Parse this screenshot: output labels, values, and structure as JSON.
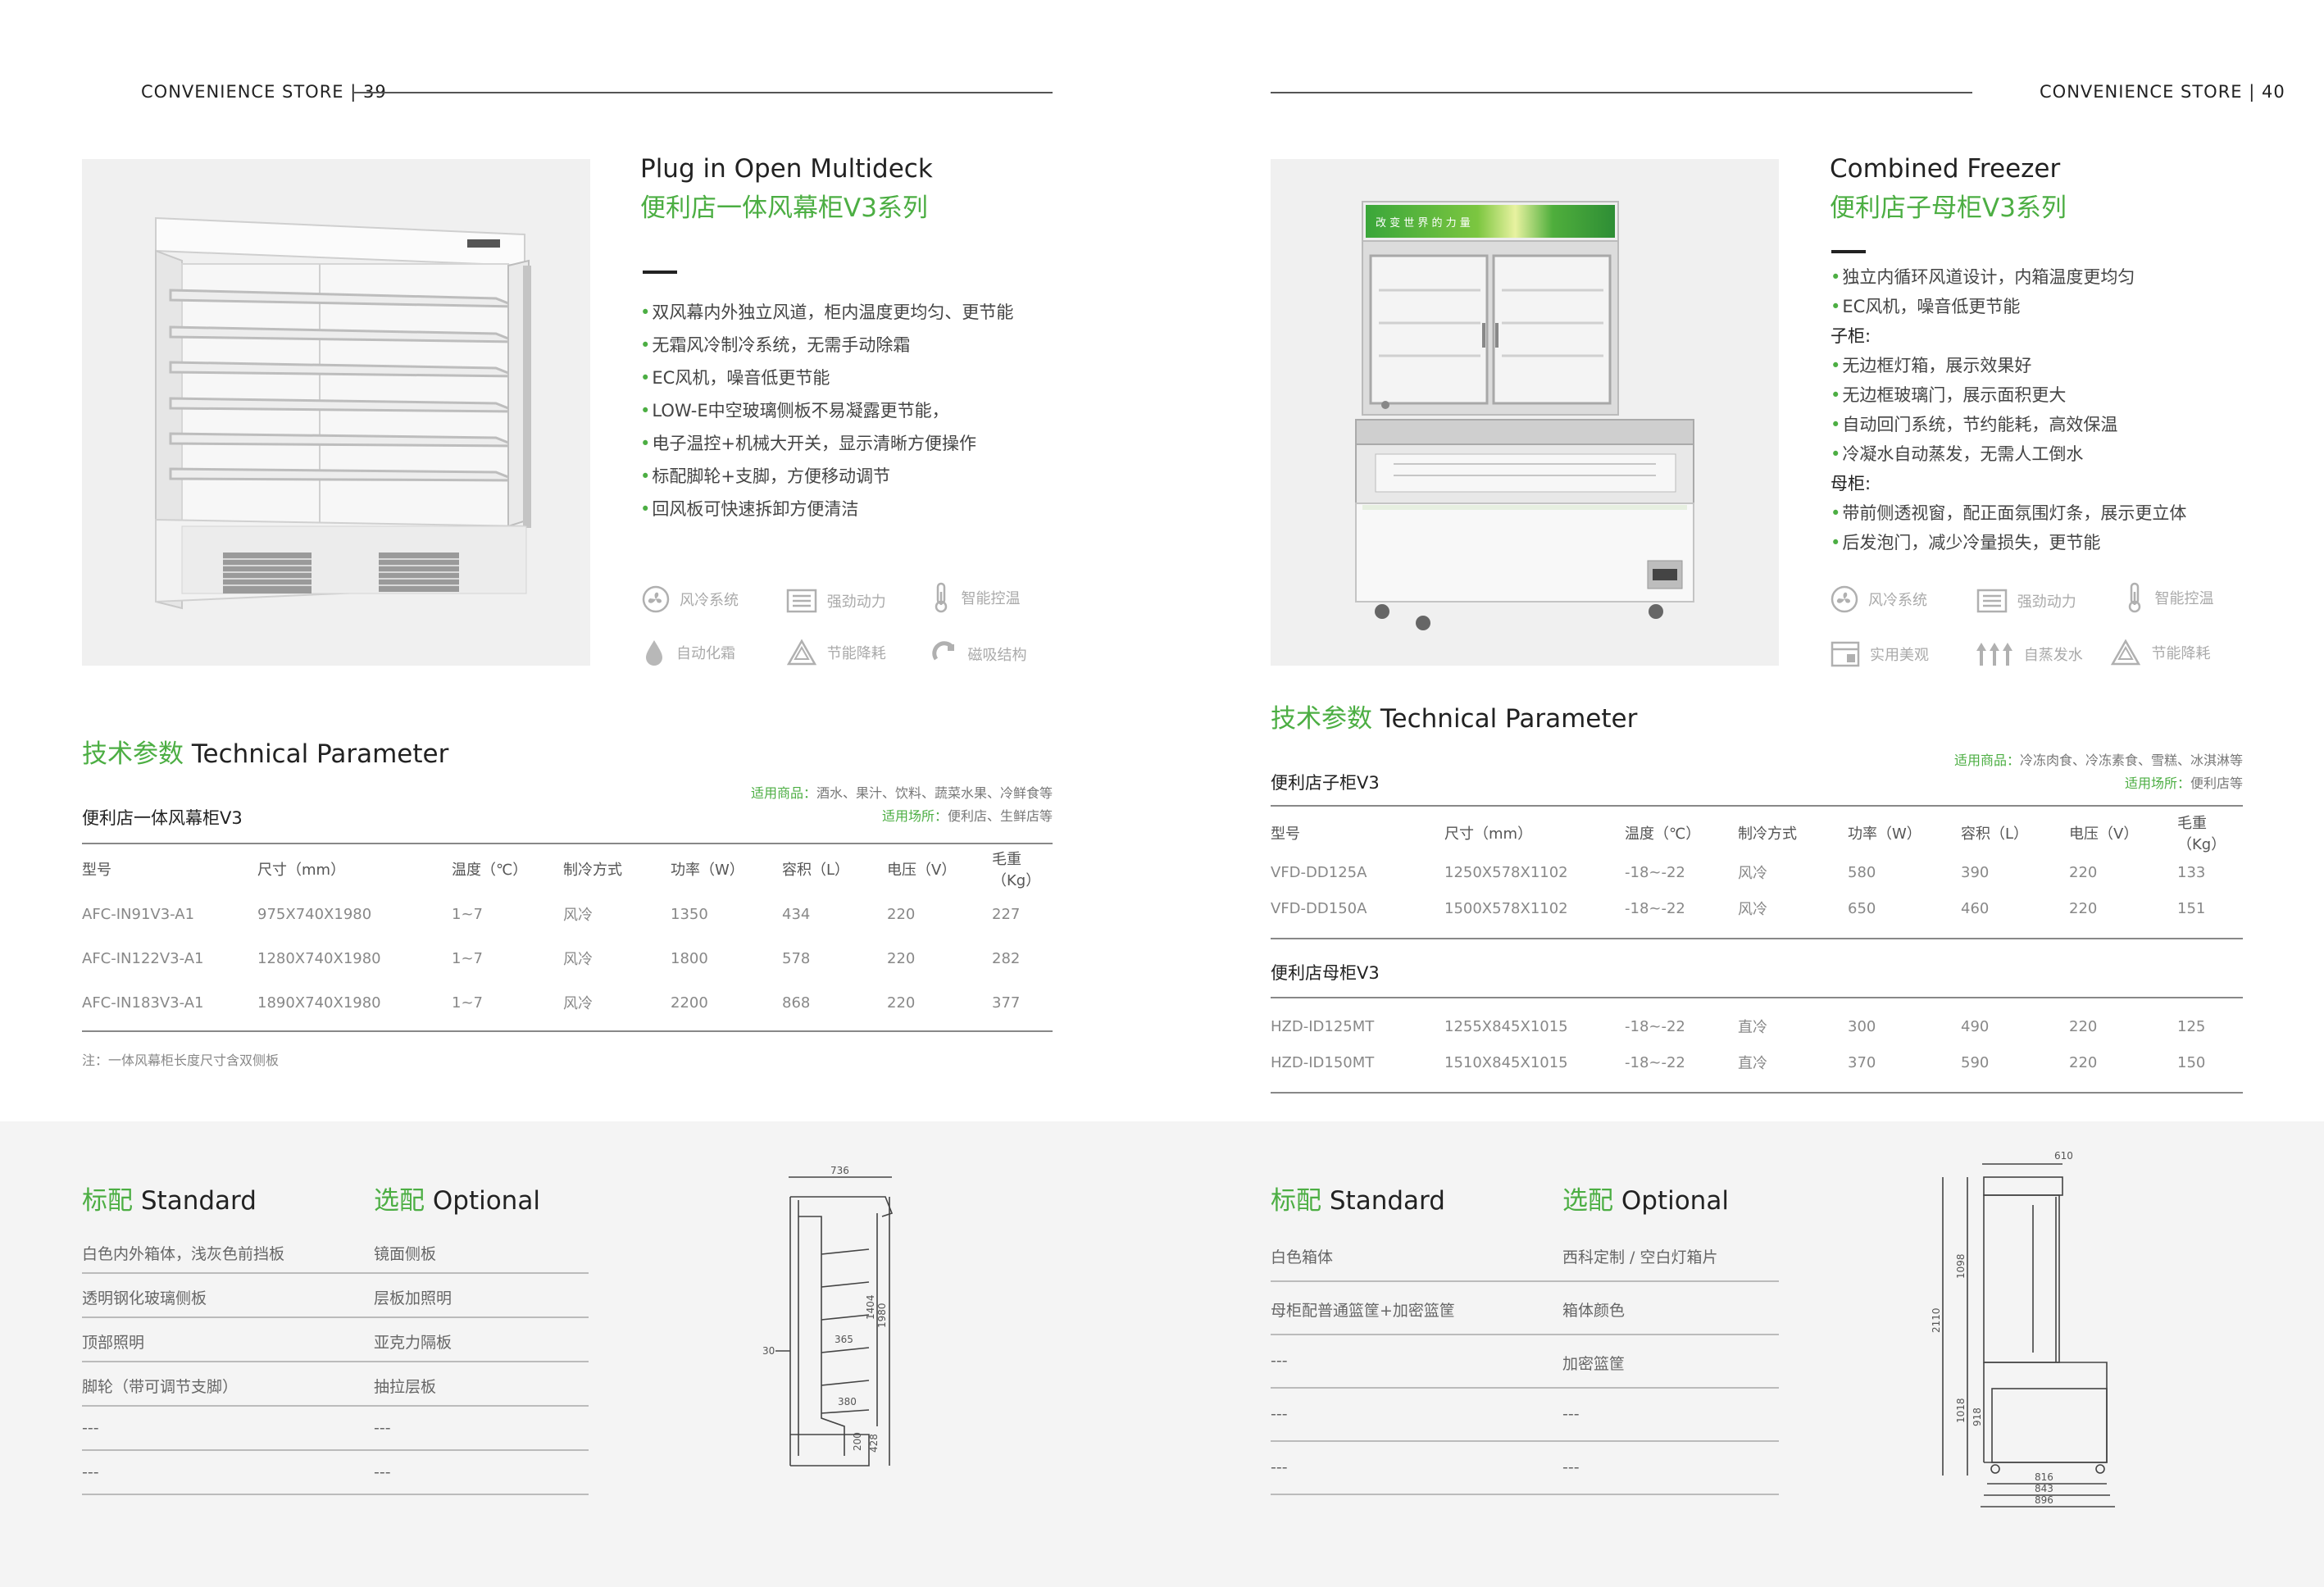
{
  "left_page": {
    "header": "CONVENIENCE STORE  |  39",
    "product": {
      "title_en": "Plug in Open Multideck",
      "title_cn": "便利店一体风幕柜V3系列",
      "features": [
        "双风幕内外独立风道，柜内温度更均匀、更节能",
        "无霜风冷制冷系统，无需手动除霜",
        "EC风机，噪音低更节能",
        "LOW-E中空玻璃侧板不易凝露更节能，",
        "电子温控+机械大开关，显示清晰方便操作",
        "标配脚轮+支脚，方便移动调节",
        "回风板可快速拆卸方便清洁"
      ],
      "icons": [
        {
          "icon": "fan-icon",
          "label": "风冷系统"
        },
        {
          "icon": "power-icon",
          "label": "强劲动力"
        },
        {
          "icon": "thermometer-icon",
          "label": "智能控温"
        },
        {
          "icon": "droplet-icon",
          "label": "自动化霜"
        },
        {
          "icon": "recycle-icon",
          "label": "节能降耗"
        },
        {
          "icon": "magnet-icon",
          "label": "磁吸结构"
        }
      ]
    },
    "tech": {
      "title_cn": "技术参数",
      "title_en": "Technical Parameter",
      "model": "便利店一体风幕柜V3",
      "applicable_goods_label": "适用商品：",
      "applicable_goods": "酒水、果汁、饮料、蔬菜水果、冷鲜食等",
      "applicable_places_label": "适用场所：",
      "applicable_places": "便利店、生鲜店等",
      "columns": [
        "型号",
        "尺寸（mm）",
        "温度（℃）",
        "制冷方式",
        "功率（W）",
        "容积（L）",
        "电压（V）",
        "毛重（Kg）"
      ],
      "rows": [
        [
          "AFC-IN91V3-A1",
          "975X740X1980",
          "1~7",
          "风冷",
          "1350",
          "434",
          "220",
          "227"
        ],
        [
          "AFC-IN122V3-A1",
          "1280X740X1980",
          "1~7",
          "风冷",
          "1800",
          "578",
          "220",
          "282"
        ],
        [
          "AFC-IN183V3-A1",
          "1890X740X1980",
          "1~7",
          "风冷",
          "2200",
          "868",
          "220",
          "377"
        ]
      ],
      "note": "注：一体风幕柜长度尺寸含双侧板"
    },
    "standard": {
      "title_cn": "标配",
      "title_en": "Standard",
      "items": [
        "白色内外箱体，浅灰色前挡板",
        "透明钢化玻璃侧板",
        "顶部照明",
        "脚轮（带可调节支脚）",
        "---",
        "---"
      ]
    },
    "optional": {
      "title_cn": "选配",
      "title_en": "Optional",
      "items": [
        "镜面侧板",
        "层板加照明",
        "亚克力隔板",
        "抽拉层板",
        "---",
        "---"
      ]
    },
    "drawing_labels": [
      "736",
      "30",
      "365",
      "380",
      "1404",
      "1980",
      "428",
      "200"
    ]
  },
  "right_page": {
    "header": "CONVENIENCE STORE  |  40",
    "product": {
      "title_en": "Combined Freezer",
      "title_cn": "便利店子母柜V3系列",
      "panel_text": "改 变 世 界 的 力 量",
      "features": [
        {
          "text": "独立内循环风道设计，内箱温度更均匀",
          "dot": true
        },
        {
          "text": "EC风机，噪音低更节能",
          "dot": true
        },
        {
          "text": "子柜:",
          "dot": false
        },
        {
          "text": "无边框灯箱，展示效果好",
          "dot": true
        },
        {
          "text": "无边框玻璃门，展示面积更大",
          "dot": true
        },
        {
          "text": "自动回门系统，节约能耗，高效保温",
          "dot": true
        },
        {
          "text": "冷凝水自动蒸发，无需人工倒水",
          "dot": true
        },
        {
          "text": "母柜:",
          "dot": false
        },
        {
          "text": "带前侧透视窗，配正面氛围灯条，展示更立体",
          "dot": true
        },
        {
          "text": "后发泡门，减少冷量损失，更节能",
          "dot": true
        }
      ],
      "icons": [
        {
          "icon": "fan-icon",
          "label": "风冷系统"
        },
        {
          "icon": "power-icon",
          "label": "强劲动力"
        },
        {
          "icon": "thermometer-icon",
          "label": "智能控温"
        },
        {
          "icon": "display-icon",
          "label": "实用美观"
        },
        {
          "icon": "evaporation-icon",
          "label": "自蒸发水"
        },
        {
          "icon": "recycle-icon",
          "label": "节能降耗"
        }
      ]
    },
    "tech": {
      "title_cn": "技术参数",
      "title_en": "Technical Parameter",
      "model_1": "便利店子柜V3",
      "model_2": "便利店母柜V3",
      "applicable_goods_label": "适用商品：",
      "applicable_goods": "冷冻肉食、冷冻素食、雪糕、冰淇淋等",
      "applicable_places_label": "适用场所：",
      "applicable_places": "便利店等",
      "columns": [
        "型号",
        "尺寸（mm）",
        "温度（℃）",
        "制冷方式",
        "功率（W）",
        "容积（L）",
        "电压（V）",
        "毛重（Kg）"
      ],
      "rows_1": [
        [
          "VFD-DD125A",
          "1250X578X1102",
          "-18~-22",
          "风冷",
          "580",
          "390",
          "220",
          "133"
        ],
        [
          "VFD-DD150A",
          "1500X578X1102",
          "-18~-22",
          "风冷",
          "650",
          "460",
          "220",
          "151"
        ]
      ],
      "rows_2": [
        [
          "HZD-ID125MT",
          "1255X845X1015",
          "-18~-22",
          "直冷",
          "300",
          "490",
          "220",
          "125"
        ],
        [
          "HZD-ID150MT",
          "1510X845X1015",
          "-18~-22",
          "直冷",
          "370",
          "590",
          "220",
          "150"
        ]
      ]
    },
    "standard": {
      "title_cn": "标配",
      "title_en": "Standard",
      "items": [
        "白色箱体",
        "母柜配普通篮筐+加密篮筐",
        "---",
        "---",
        "---"
      ]
    },
    "optional": {
      "title_cn": "选配",
      "title_en": "Optional",
      "items": [
        "西科定制 / 空白灯箱片",
        "箱体颜色",
        "加密篮筐",
        "---",
        "---"
      ]
    },
    "drawing_labels": [
      "610",
      "1098",
      "2110",
      "1018",
      "918",
      "816",
      "843",
      "896"
    ]
  },
  "colors": {
    "accent_green": "#4cae43",
    "text_dark": "#222222",
    "gray_band": "#f4f4f4"
  }
}
